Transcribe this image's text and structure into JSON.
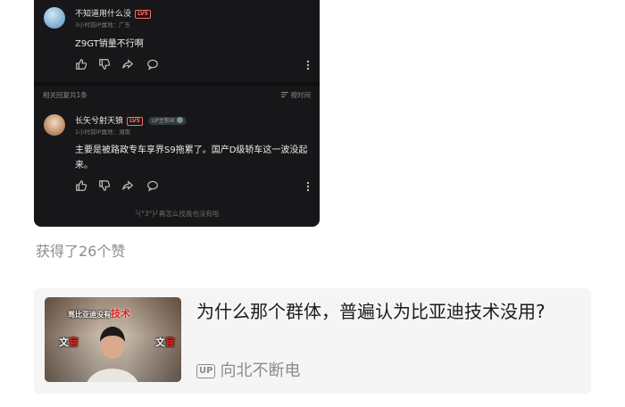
{
  "comments": [
    {
      "username": "不知道用什么没",
      "level": "LV5",
      "meta": "3小时前IP属地：广东",
      "text": "Z9GT销量不行啊"
    },
    {
      "username": "长矢兮射天狼",
      "level": "LV5",
      "fan_badge": "UP主粉丝",
      "meta": "1小时前IP属地：湖南",
      "text": "主要是被路政专车享界S9拖累了。国产D级轿车这一波没起来。"
    }
  ],
  "related_count": "相关回复共1条",
  "sort_label": "按时间",
  "footer_text": "╰(°3°)╯再怎么找我也没有啦",
  "likes_text": "获得了26个赞",
  "video": {
    "title": "为什么那个群体，普遍认为比亚迪技术没用?",
    "up_badge": "UP",
    "author": "向北不断电",
    "thumb_caption_prefix": "骂比亚迪没有",
    "thumb_caption_accent": "技术",
    "thumb_left": "文",
    "thumb_left_accent": "盲",
    "thumb_right": "文",
    "thumb_right_accent": "盲"
  },
  "icons": [
    "like-icon",
    "dislike-icon",
    "share-icon",
    "reply-icon",
    "more-icon",
    "sort-icon"
  ],
  "colors": {
    "card_bg": "#17171a",
    "level_badge": "#ff6a5b",
    "thumb_accent": "#e2241c"
  }
}
